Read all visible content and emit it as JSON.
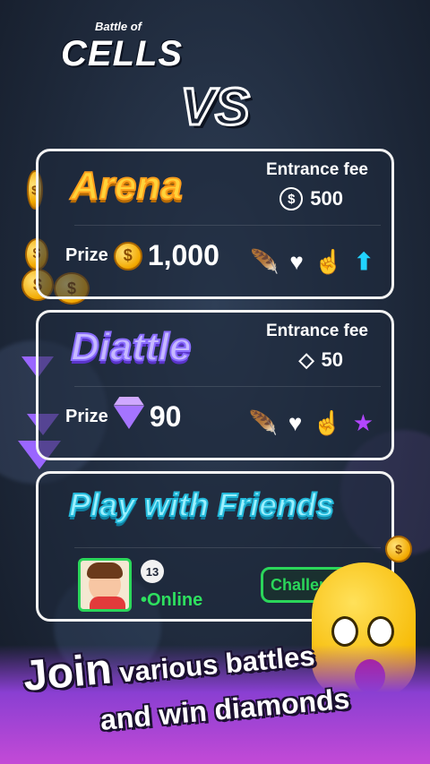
{
  "app": {
    "logo_top": "Battle of",
    "logo_main": "CELLS"
  },
  "vs_label": "VS",
  "arena": {
    "title": "Arena",
    "entrance_fee_label": "Entrance fee",
    "fee_currency_icon": "dollar-coin-icon",
    "fee_value": "500",
    "prize_label": "Prize",
    "prize_icon": "gold-coin-icon",
    "prize_amount": "1,000",
    "actions": [
      "feather-icon",
      "heart-icon",
      "pointing-hand-icon",
      "up-arrow-icon"
    ]
  },
  "diattle": {
    "title": "Diattle",
    "entrance_fee_label": "Entrance fee",
    "fee_currency_icon": "diamond-outline-icon",
    "fee_value": "50",
    "prize_label": "Prize",
    "prize_icon": "purple-diamond-icon",
    "prize_amount": "90",
    "actions": [
      "feather-icon",
      "heart-icon",
      "pointing-hand-icon",
      "star-icon"
    ]
  },
  "friends": {
    "title": "Play with Friends",
    "friend_level": "13",
    "friend_status": "•Online",
    "challenge_label": "Challenge"
  },
  "banner": {
    "line1_big": "Join",
    "line1_rest": " various battles",
    "line2": "and win diamonds"
  },
  "colors": {
    "arena_title": "#ffd33a",
    "diattle_title": "#c6b9ff",
    "friends_title": "#9bf0ff",
    "online_green": "#2ee05f",
    "up_arrow": "#21d3ff",
    "star": "#b246ff"
  }
}
